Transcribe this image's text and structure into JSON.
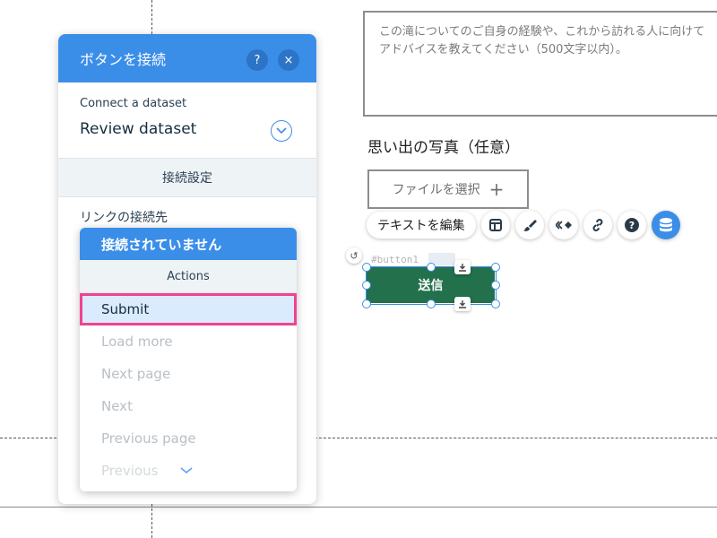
{
  "form": {
    "textarea_text": "この滝についてのご自身の経験や、これから訪れる人に向けてアドバイスを教えてください（500文字以内）。",
    "photo_label": "思い出の写真（任意）",
    "file_button_label": "ファイルを選択"
  },
  "toolbar": {
    "edit_text_label": "テキストを編集",
    "tools": [
      "layout-icon",
      "paint-brush-icon",
      "animation-icon",
      "link-icon",
      "help-icon",
      "database-icon"
    ]
  },
  "selected_element": {
    "id_tag": "#button1",
    "button_label": "送信"
  },
  "panel": {
    "title": "ボタンを接続",
    "help_label": "?",
    "close_label": "×",
    "dataset_label": "Connect a dataset",
    "dataset_value": "Review dataset",
    "settings_section": "接続設定",
    "link_target_label": "リンクの接続先"
  },
  "dropdown": {
    "selected": "接続されていません",
    "group": "Actions",
    "items": [
      "Submit",
      "Load more",
      "Next page",
      "Next",
      "Previous page",
      "Previous"
    ],
    "highlighted_index": 0
  },
  "colors": {
    "accent": "#3b8ee8",
    "submit_button": "#23704c",
    "highlight_border": "#f0438f"
  }
}
